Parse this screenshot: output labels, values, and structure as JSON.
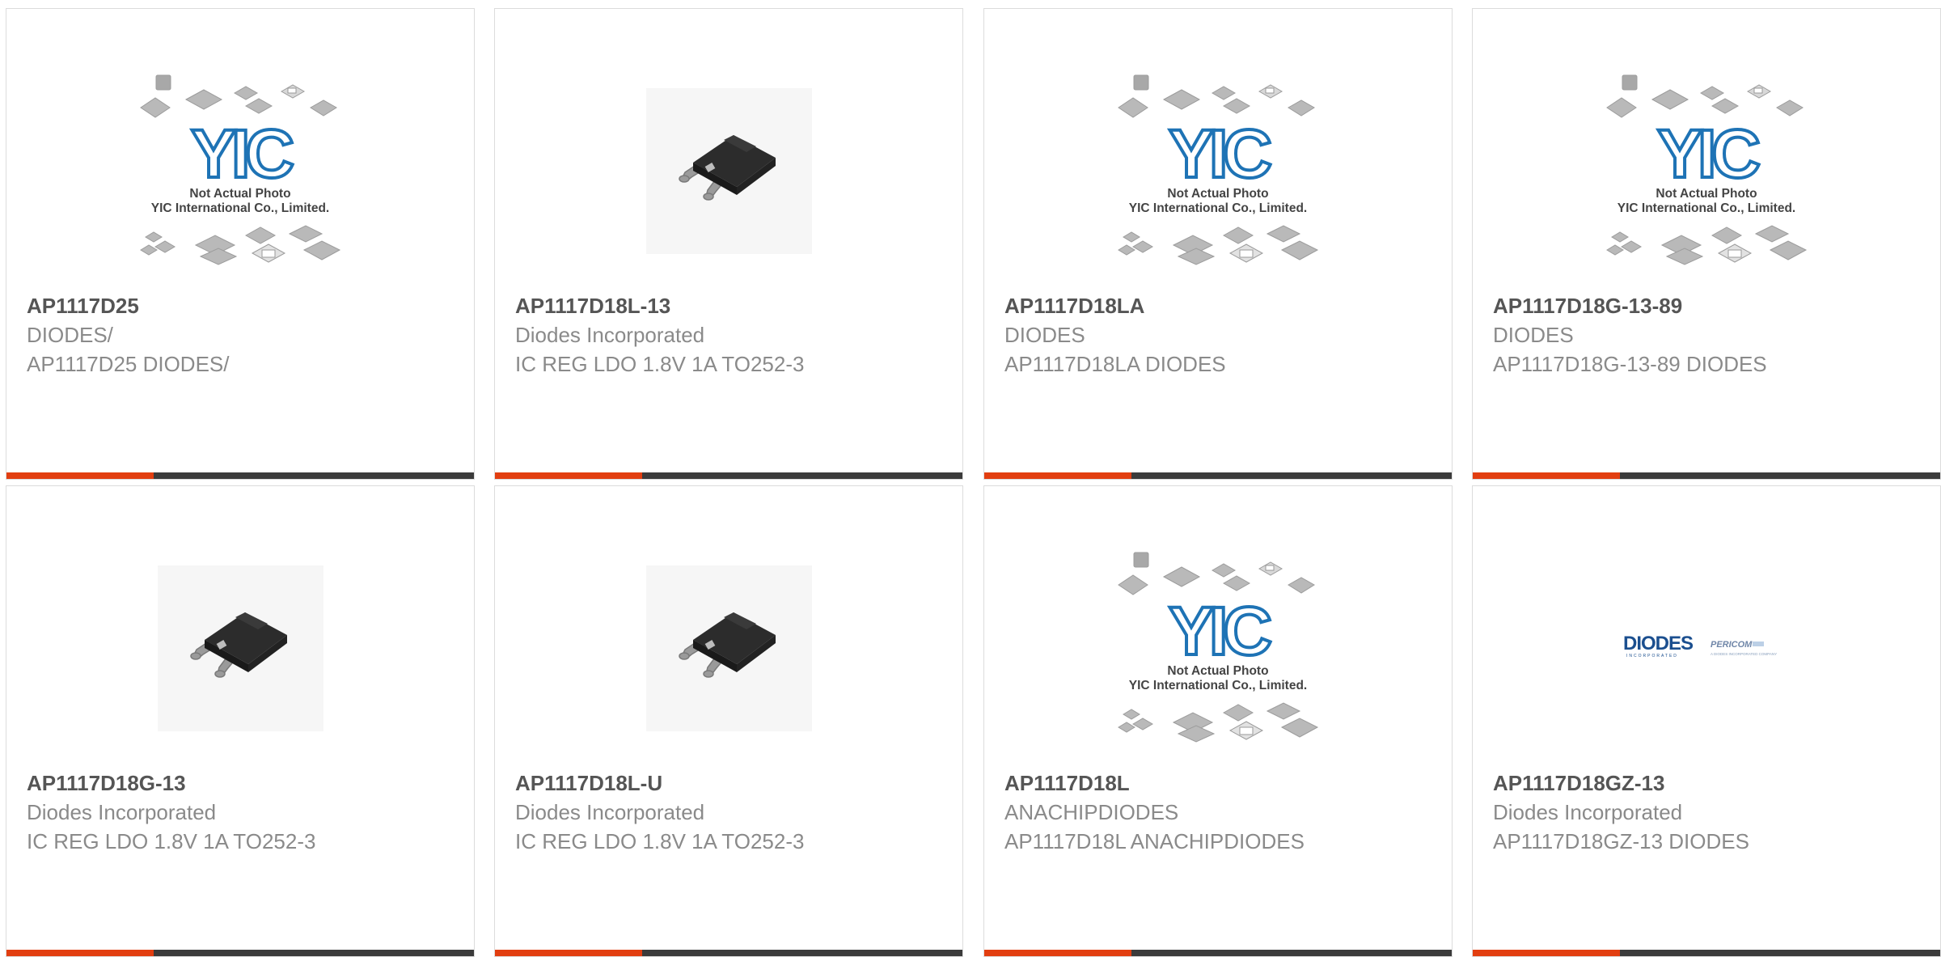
{
  "colors": {
    "accent": "#e23e10",
    "bar": "#3b3b3b",
    "part_number": "#555555",
    "text": "#8a8a8a",
    "yic_blue": "#1e73b5",
    "diodes_blue": "#1b4f8f"
  },
  "placeholder": {
    "line1": "Not Actual Photo",
    "line2": "YIC International Co., Limited.",
    "logo": "YIC"
  },
  "diodes_logo": {
    "brand": "DIODES",
    "tagline": "INCORPORATED",
    "secondary": "PERICOM",
    "secondary_tagline": "A DIODES INCORPORATED COMPANY"
  },
  "products": [
    {
      "part_number": "AP1117D25",
      "manufacturer": "DIODES/",
      "description": "AP1117D25 DIODES/",
      "image": "not-actual-photo-icon"
    },
    {
      "part_number": "AP1117D18L-13",
      "manufacturer": "Diodes Incorporated",
      "description": "IC REG LDO 1.8V 1A TO252-3",
      "image": "to252-package-icon"
    },
    {
      "part_number": "AP1117D18LA",
      "manufacturer": "DIODES",
      "description": "AP1117D18LA DIODES",
      "image": "not-actual-photo-icon"
    },
    {
      "part_number": "AP1117D18G-13-89",
      "manufacturer": "DIODES",
      "description": "AP1117D18G-13-89 DIODES",
      "image": "not-actual-photo-icon"
    },
    {
      "part_number": "AP1117D18G-13",
      "manufacturer": "Diodes Incorporated",
      "description": "IC REG LDO 1.8V 1A TO252-3",
      "image": "to252-package-icon"
    },
    {
      "part_number": "AP1117D18L-U",
      "manufacturer": "Diodes Incorporated",
      "description": "IC REG LDO 1.8V 1A TO252-3",
      "image": "to252-package-icon"
    },
    {
      "part_number": "AP1117D18L",
      "manufacturer": "ANACHIPDIODES",
      "description": "AP1117D18L ANACHIPDIODES",
      "image": "not-actual-photo-icon"
    },
    {
      "part_number": "AP1117D18GZ-13",
      "manufacturer": "Diodes Incorporated",
      "description": "AP1117D18GZ-13 DIODES",
      "image": "diodes-logo-icon"
    }
  ]
}
